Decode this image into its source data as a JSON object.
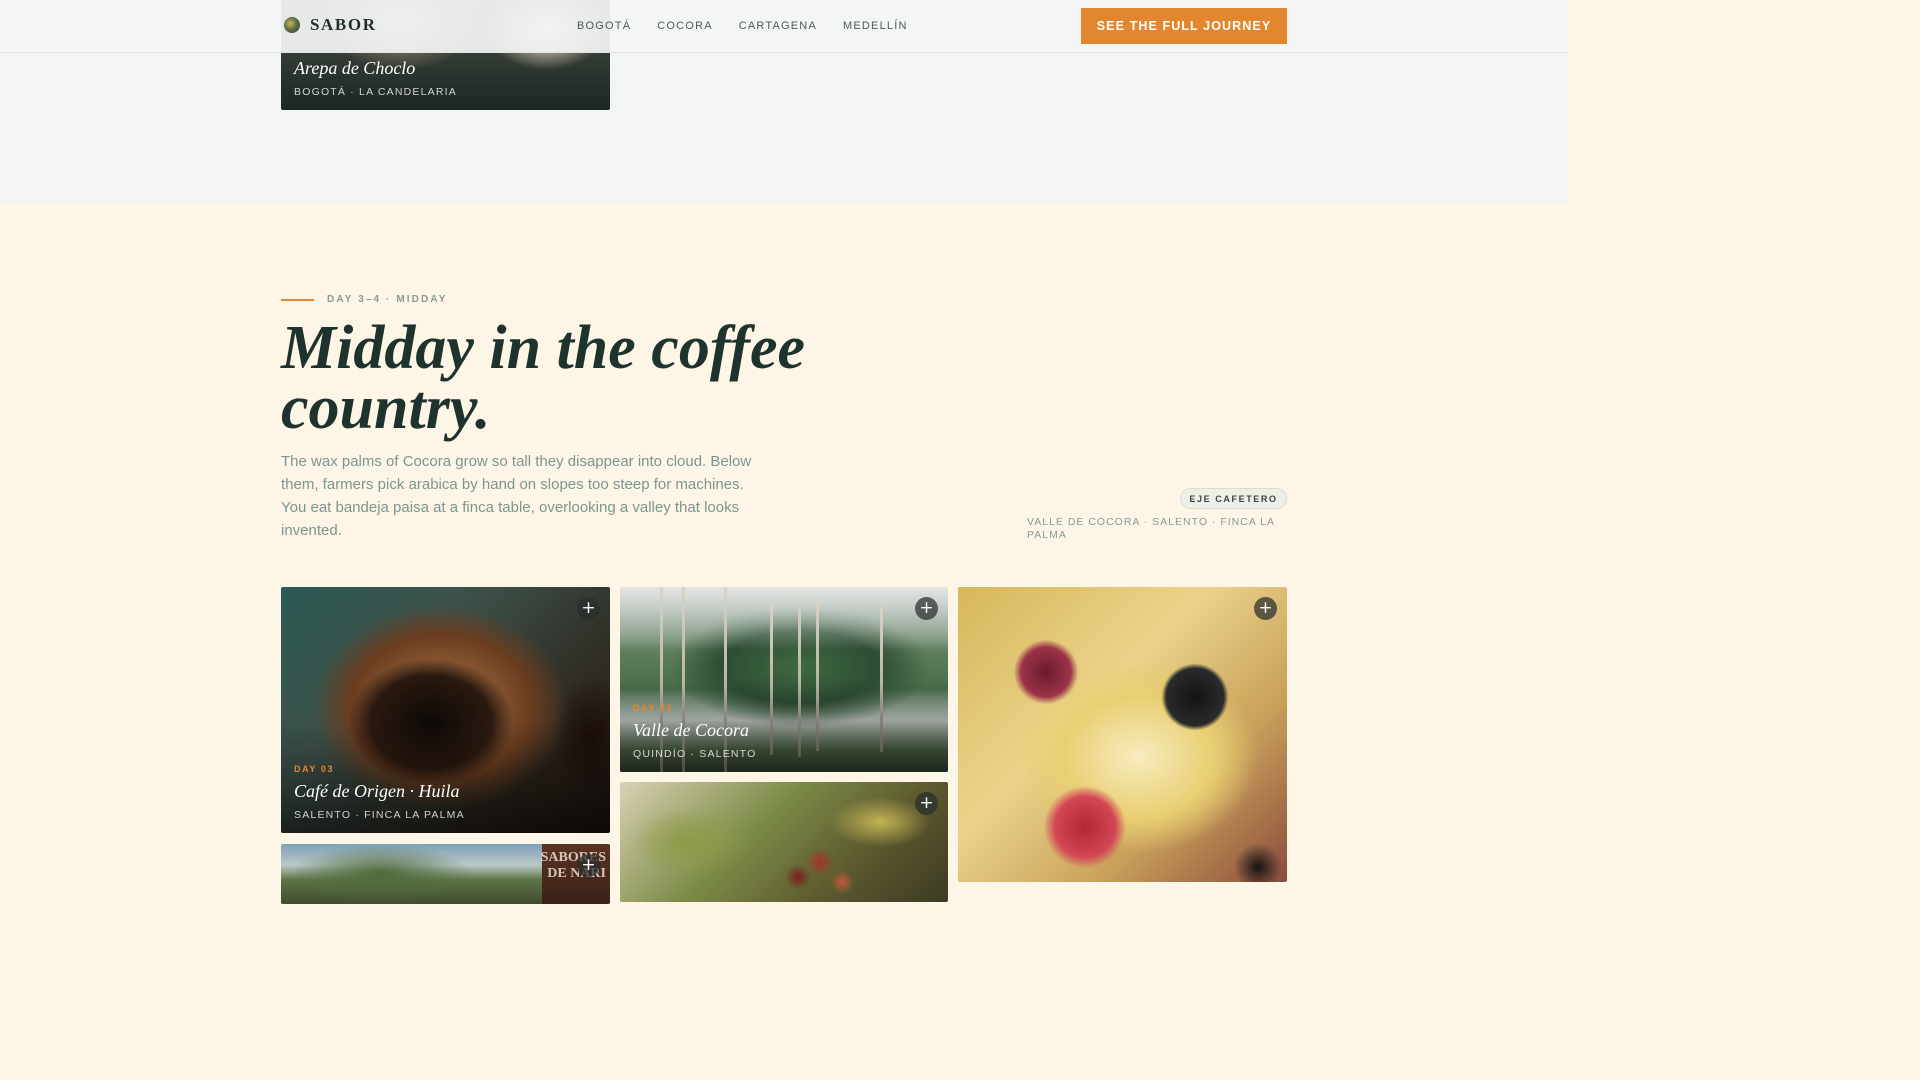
{
  "nav": {
    "brand": "SABOR",
    "links": [
      "BOGOTÁ",
      "COCORA",
      "CARTAGENA",
      "MEDELLÍN"
    ],
    "cta": "SEE THE FULL JOURNEY"
  },
  "previous_card": {
    "title": "Arepa de Choclo",
    "location": "BOGOTÁ · LA CANDELARIA"
  },
  "section": {
    "eyebrow": "DAY 3–4 · MIDDAY",
    "headline": "Midday in the coffee country.",
    "lede": "The wax palms of Cocora grow so tall they disappear into cloud. Below them, farmers pick arabica by hand on slopes too steep for machines. You eat bandeja paisa at a finca table, overlooking a valley that looks invented.",
    "region_badge": "EJE CAFETERO",
    "region_places": "VALLE DE COCORA · SALENTO · FINCA LA PALMA"
  },
  "gallery": {
    "cafe": {
      "day": "DAY 03",
      "title": "Café de Origen · Huila",
      "location": "SALENTO · FINCA LA PALMA"
    },
    "cocora": {
      "day": "DAY 03",
      "title": "Valle de Cocora",
      "location": "QUINDÍO · SALENTO"
    },
    "sabores_sign": "SABORES\nDE NARI"
  },
  "icons": {
    "plus": "+"
  },
  "colors": {
    "accent": "#e3872e",
    "heading": "#1e332e",
    "section_bg": "#fdf6e7",
    "nav_bg": "#f3f5f4"
  }
}
